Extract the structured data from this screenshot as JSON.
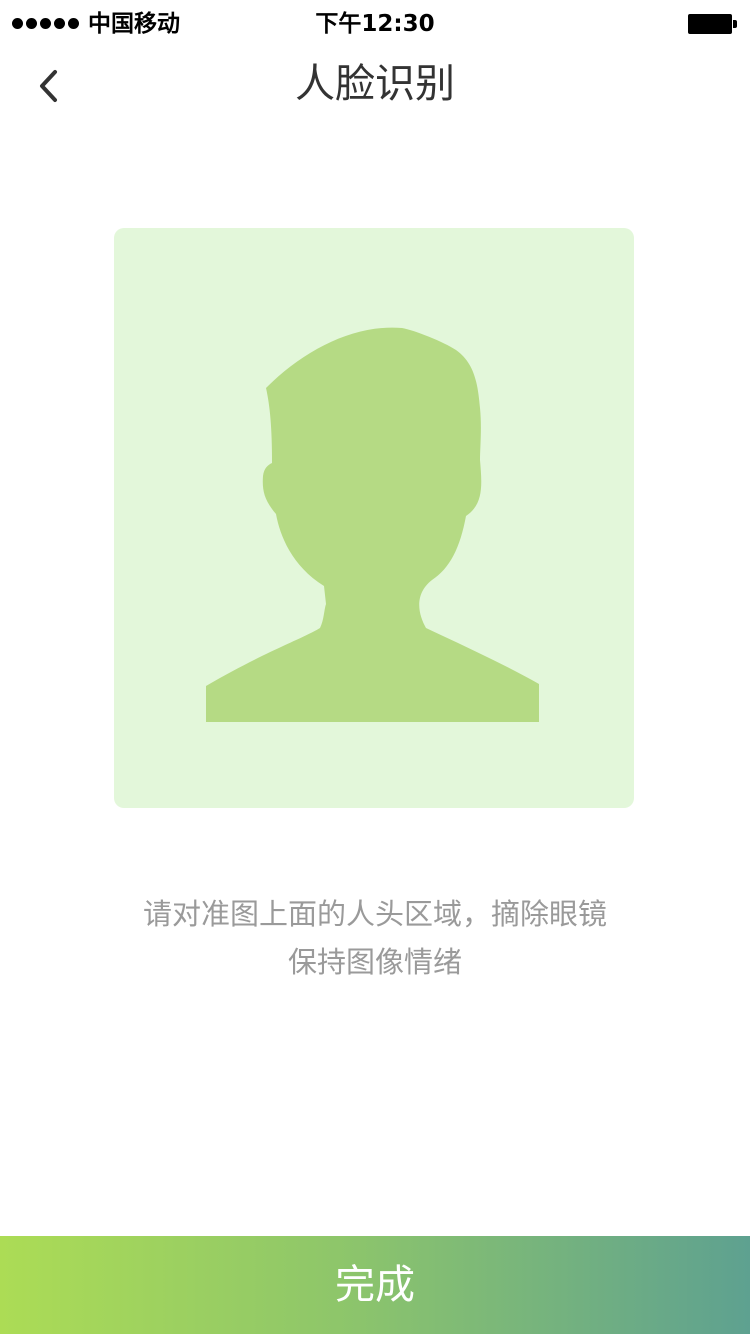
{
  "status_bar": {
    "carrier": "中国移动",
    "time": "下午12:30",
    "signal_bars": 5,
    "signal_icon": "signal-dots-icon",
    "battery_icon": "battery-full-icon"
  },
  "nav": {
    "title": "人脸识别",
    "back_icon": "chevron-left-icon"
  },
  "face_frame": {
    "background_color": "#e3f7da",
    "silhouette_color": "#b5da84",
    "icon": "person-silhouette-icon"
  },
  "instructions": {
    "line1": "请对准图上面的人头区域，摘除眼镜",
    "line2": "保持图像情绪"
  },
  "footer": {
    "done_label": "完成",
    "gradient_start": "#acdc55",
    "gradient_end": "#5ea190"
  }
}
